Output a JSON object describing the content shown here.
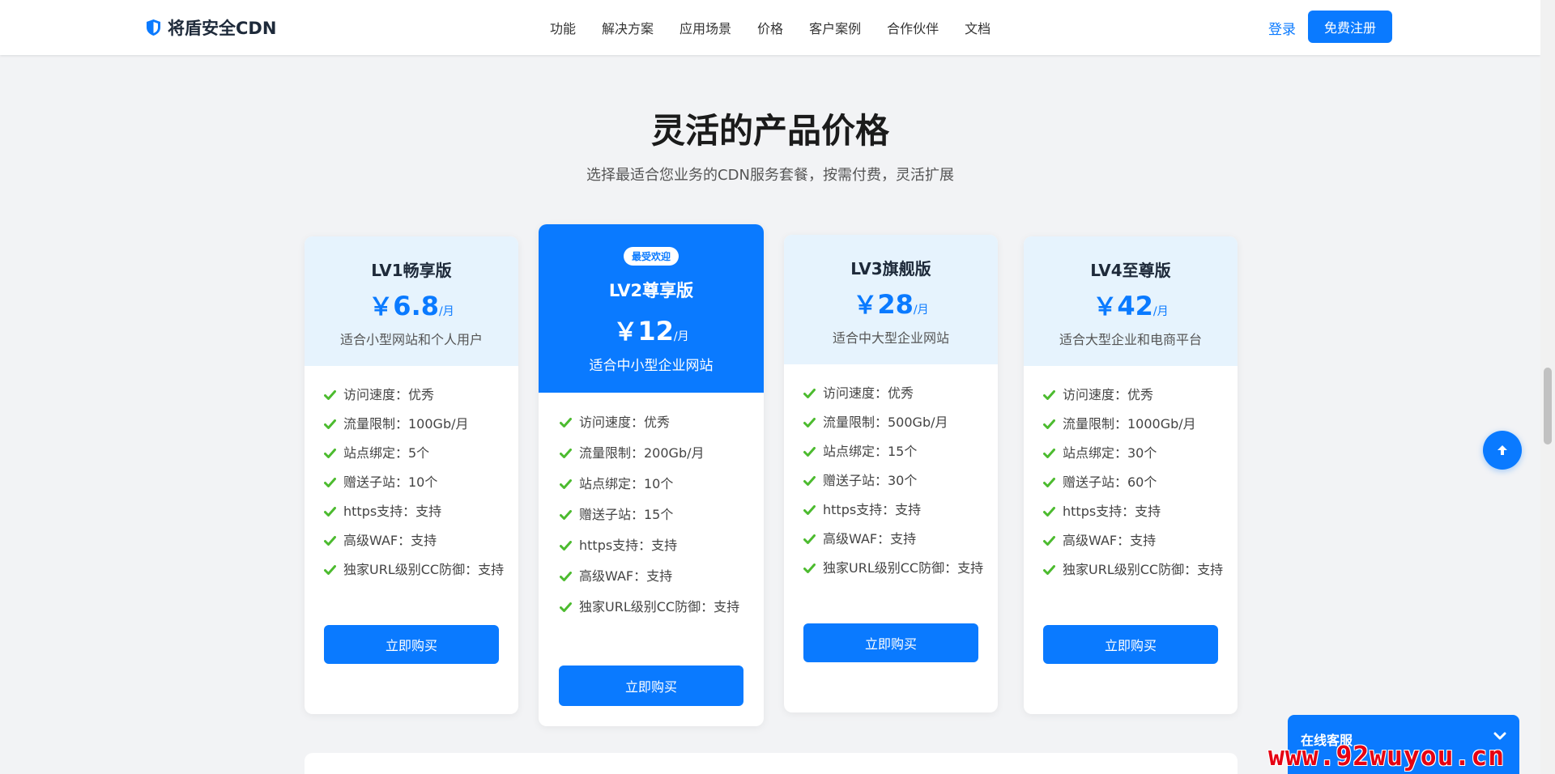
{
  "brand": {
    "name": "将盾安全CDN",
    "accent": "#0a7aff"
  },
  "nav": {
    "items": [
      "功能",
      "解决方案",
      "应用场景",
      "价格",
      "客户案例",
      "合作伙伴",
      "文档"
    ],
    "login_label": "登录",
    "register_label": "免费注册"
  },
  "section": {
    "title": "灵活的产品价格",
    "subtitle": "选择最适合您业务的CDN服务套餐，按需付费，灵活扩展"
  },
  "plans": [
    {
      "name": "LV1畅享版",
      "currency": "￥",
      "price": "6.8",
      "period": "/月",
      "desc": "适合小型网站和个人用户",
      "features": [
        "访问速度：优秀",
        "流量限制：100Gb/月",
        "站点绑定：5个",
        "赠送子站：10个",
        "https支持：支持",
        "高级WAF：支持",
        "独家URL级别CC防御：支持"
      ],
      "button": "立即购买"
    },
    {
      "name": "LV2尊享版",
      "badge": "最受欢迎",
      "currency": "￥",
      "price": "12",
      "period": "/月",
      "desc": "适合中小型企业网站",
      "features": [
        "访问速度：优秀",
        "流量限制：200Gb/月",
        "站点绑定：10个",
        "赠送子站：15个",
        "https支持：支持",
        "高级WAF：支持",
        "独家URL级别CC防御：支持"
      ],
      "button": "立即购买"
    },
    {
      "name": "LV3旗舰版",
      "currency": "￥",
      "price": "28",
      "period": "/月",
      "desc": "适合中大型企业网站",
      "features": [
        "访问速度：优秀",
        "流量限制：500Gb/月",
        "站点绑定：15个",
        "赠送子站：30个",
        "https支持：支持",
        "高级WAF：支持",
        "独家URL级别CC防御：支持"
      ],
      "button": "立即购买"
    },
    {
      "name": "LV4至尊版",
      "currency": "￥",
      "price": "42",
      "period": "/月",
      "desc": "适合大型企业和电商平台",
      "features": [
        "访问速度：优秀",
        "流量限制：1000Gb/月",
        "站点绑定：30个",
        "赠送子站：60个",
        "https支持：支持",
        "高级WAF：支持",
        "独家URL级别CC防御：支持"
      ],
      "button": "立即购买"
    }
  ],
  "widgets": {
    "back_to_top_icon": "arrow-up-icon",
    "customer_service": "在线客服",
    "watermark": "www.92wuyou.cn"
  }
}
